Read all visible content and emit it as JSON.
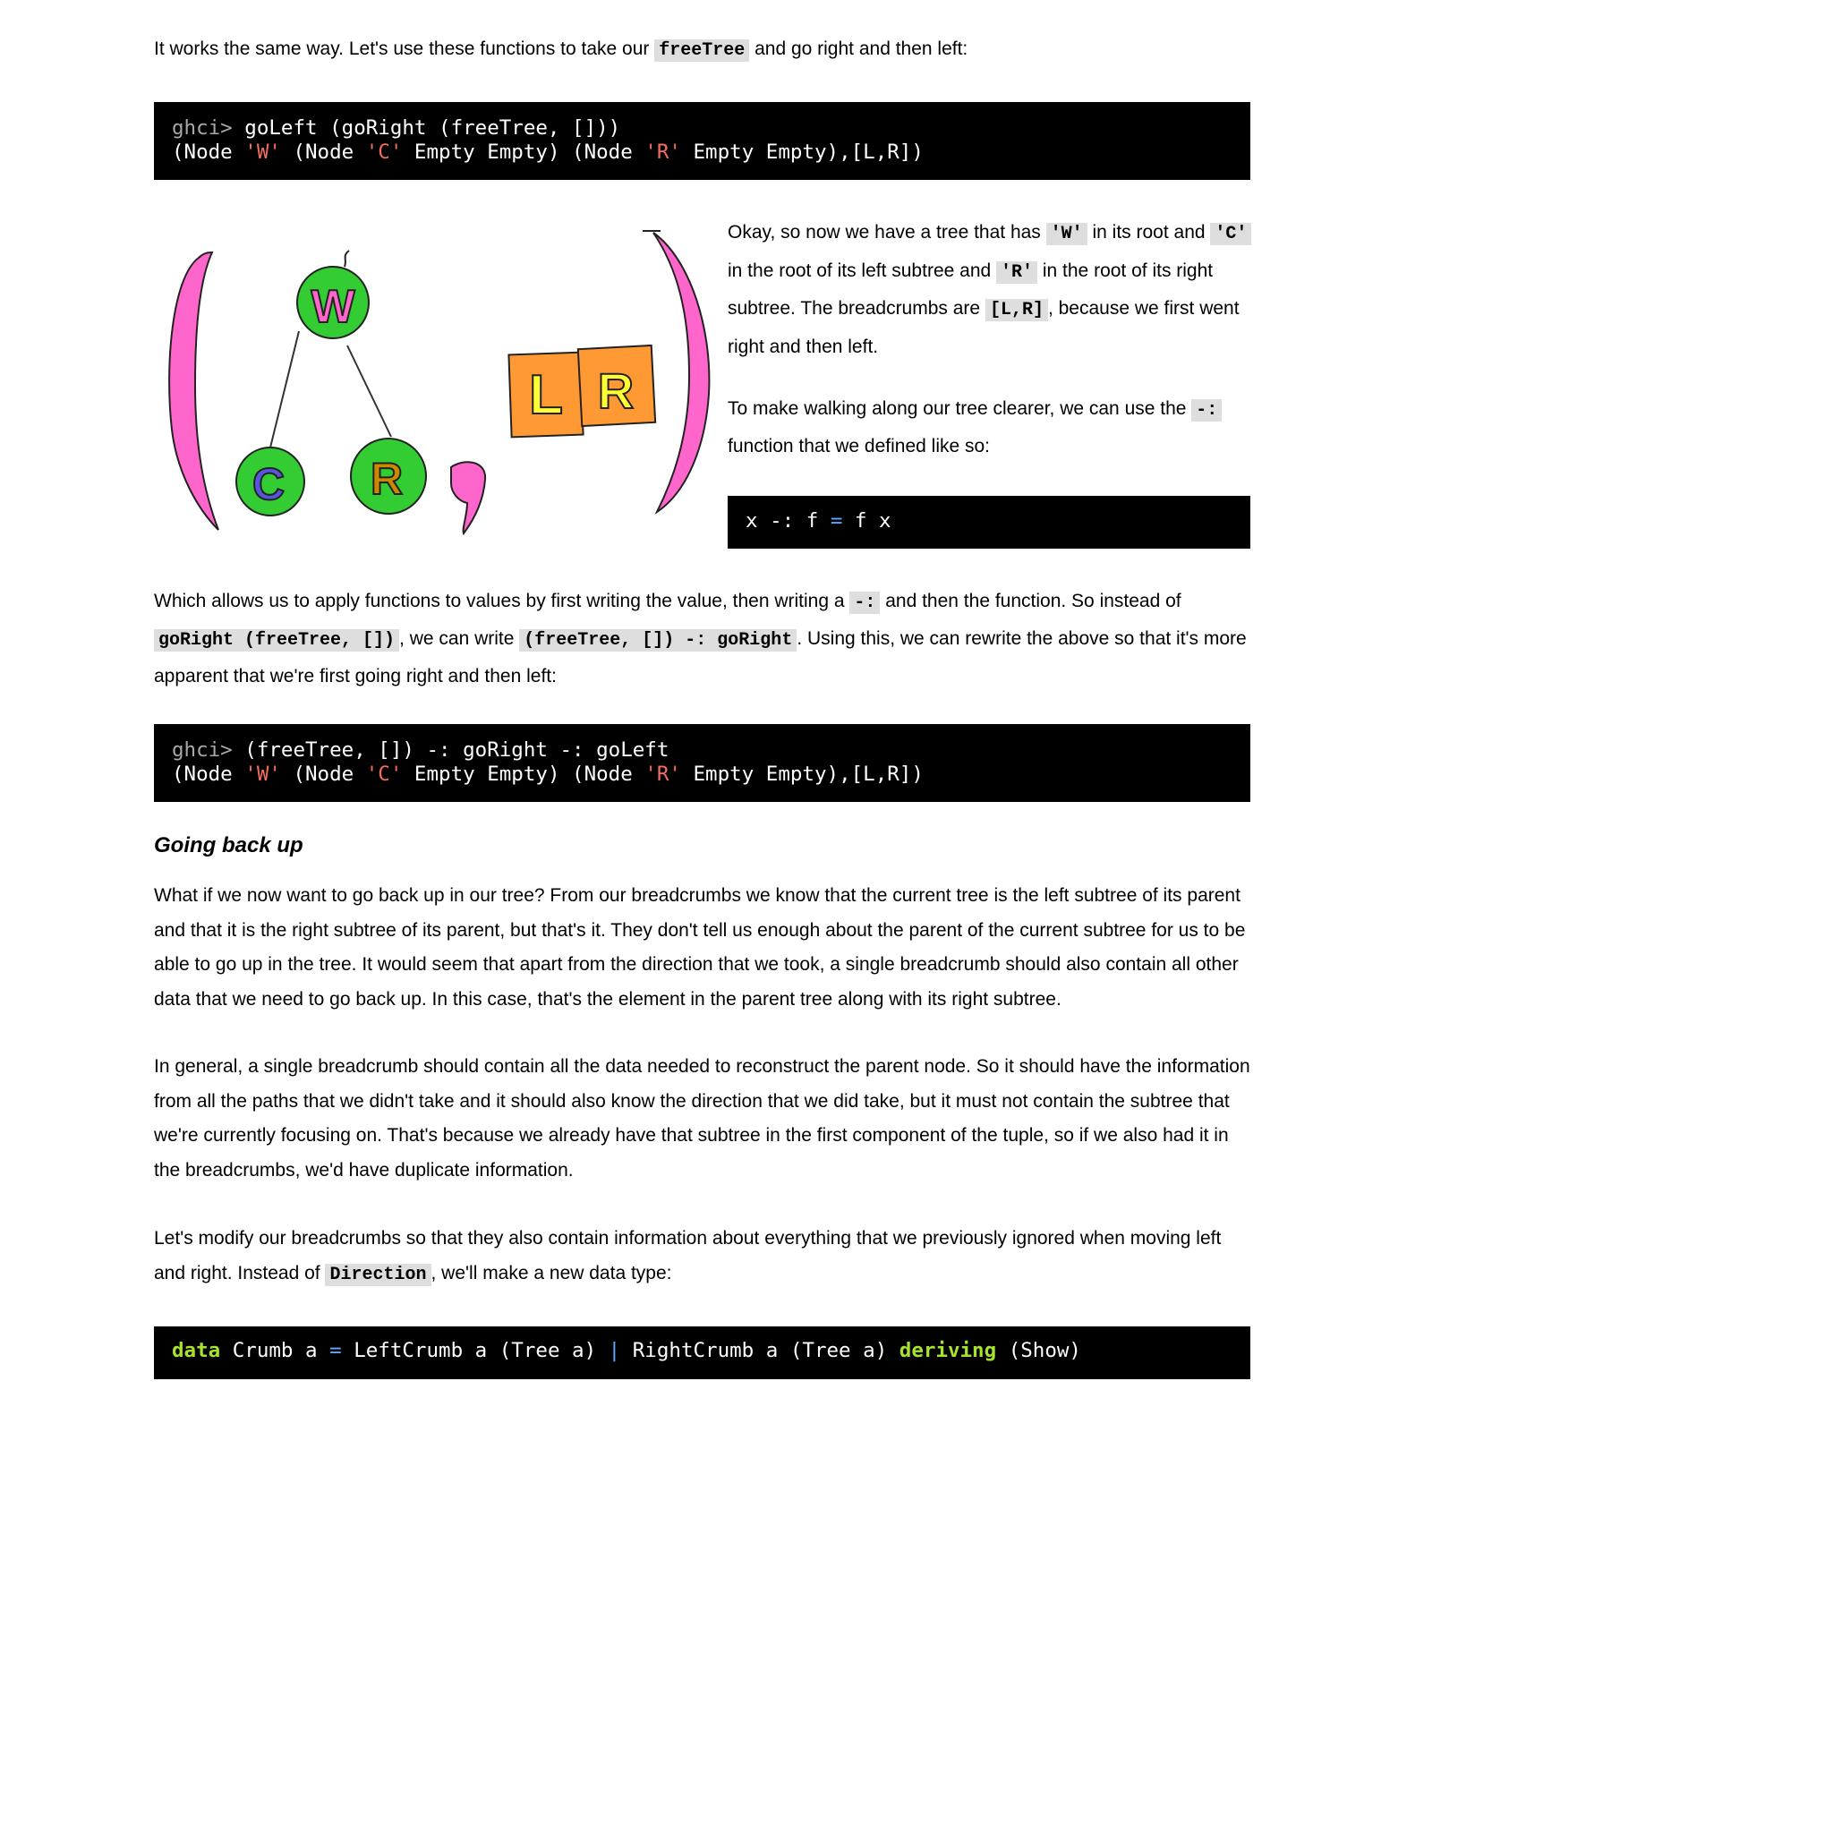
{
  "p1": {
    "text_a": "It works the same way. Let's use these functions to take our ",
    "code_a": "freeTree",
    "text_b": " and go right and then left:"
  },
  "code1": {
    "prompt": "ghci>",
    "cmd": " goLeft (goRight (freeTree, []))",
    "out_1": "(Node ",
    "out_w": "'W'",
    "out_2": " (Node ",
    "out_c": "'C'",
    "out_3": " Empty Empty) (Node ",
    "out_r": "'R'",
    "out_4": " Empty Empty),[L,R])"
  },
  "illustration": {
    "node_root": "W",
    "node_left": "C",
    "node_right": "R",
    "crumb_1": "L",
    "crumb_2": "R",
    "colors": {
      "paren": "#ff66cc",
      "node": "#33cc33",
      "box": "#ff9933",
      "letter": "#ffff33",
      "c_letter": "#5555dd",
      "r_letter": "#cc8800"
    }
  },
  "p2": {
    "t1": "Okay, so now we have a tree that has ",
    "c1": "'W'",
    "t2": " in its root and ",
    "c2": "'C'",
    "t3": " in the root of its left subtree and ",
    "c3": "'R'",
    "t4": " in the root of its right subtree. The breadcrumbs are ",
    "c4": "[L,R]",
    "t5": ", because we first went right and then left."
  },
  "p3": {
    "t1": "To make walking along our tree clearer, we can use the ",
    "c1": "-:",
    "t2": " function that we defined like so:"
  },
  "code2": {
    "a": "x -: f ",
    "eq": "=",
    "b": " f x"
  },
  "p4": {
    "t1": "Which allows us to apply functions to values by first writing the value, then writing a ",
    "c1": "-:",
    "t2": " and then the function. So instead of ",
    "c2": "goRight (freeTree, [])",
    "t3": ", we can write ",
    "c3": "(freeTree, []) -: goRight",
    "t4": ". Using this, we can rewrite the above so that it's more apparent that we're first going right and then left:"
  },
  "code3": {
    "prompt": "ghci>",
    "cmd": " (freeTree, []) -: goRight -: goLeft",
    "out_1": "(Node ",
    "out_w": "'W'",
    "out_2": " (Node ",
    "out_c": "'C'",
    "out_3": " Empty Empty) (Node ",
    "out_r": "'R'",
    "out_4": " Empty Empty),[L,R])"
  },
  "heading": "Going back up",
  "p5": "What if we now want to go back up in our tree? From our breadcrumbs we know that the current tree is the left subtree of its parent and that it is the right subtree of its parent, but that's it. They don't tell us enough about the parent of the current subtree for us to be able to go up in the tree. It would seem that apart from the direction that we took, a single breadcrumb should also contain all other data that we need to go back up. In this case, that's the element in the parent tree along with its right subtree.",
  "p6": "In general, a single breadcrumb should contain all the data needed to reconstruct the parent node. So it should have the information from all the paths that we didn't take and it should also know the direction that we did take, but it must not contain the subtree that we're currently focusing on. That's because we already have that subtree in the first component of the tuple, so if we also had it in the breadcrumbs, we'd have duplicate information.",
  "p7": {
    "t1": "Let's modify our breadcrumbs so that they also contain information about everything that we previously ignored when moving left and right. Instead of ",
    "c1": "Direction",
    "t2": ", we'll make a new data type:"
  },
  "code4": {
    "kw1": "data",
    "a": " Crumb a ",
    "eq": "=",
    "b": " LeftCrumb a (Tree a) ",
    "bar": "|",
    "c": " RightCrumb a (Tree a) ",
    "kw2": "deriving",
    "d": " (Show)"
  }
}
